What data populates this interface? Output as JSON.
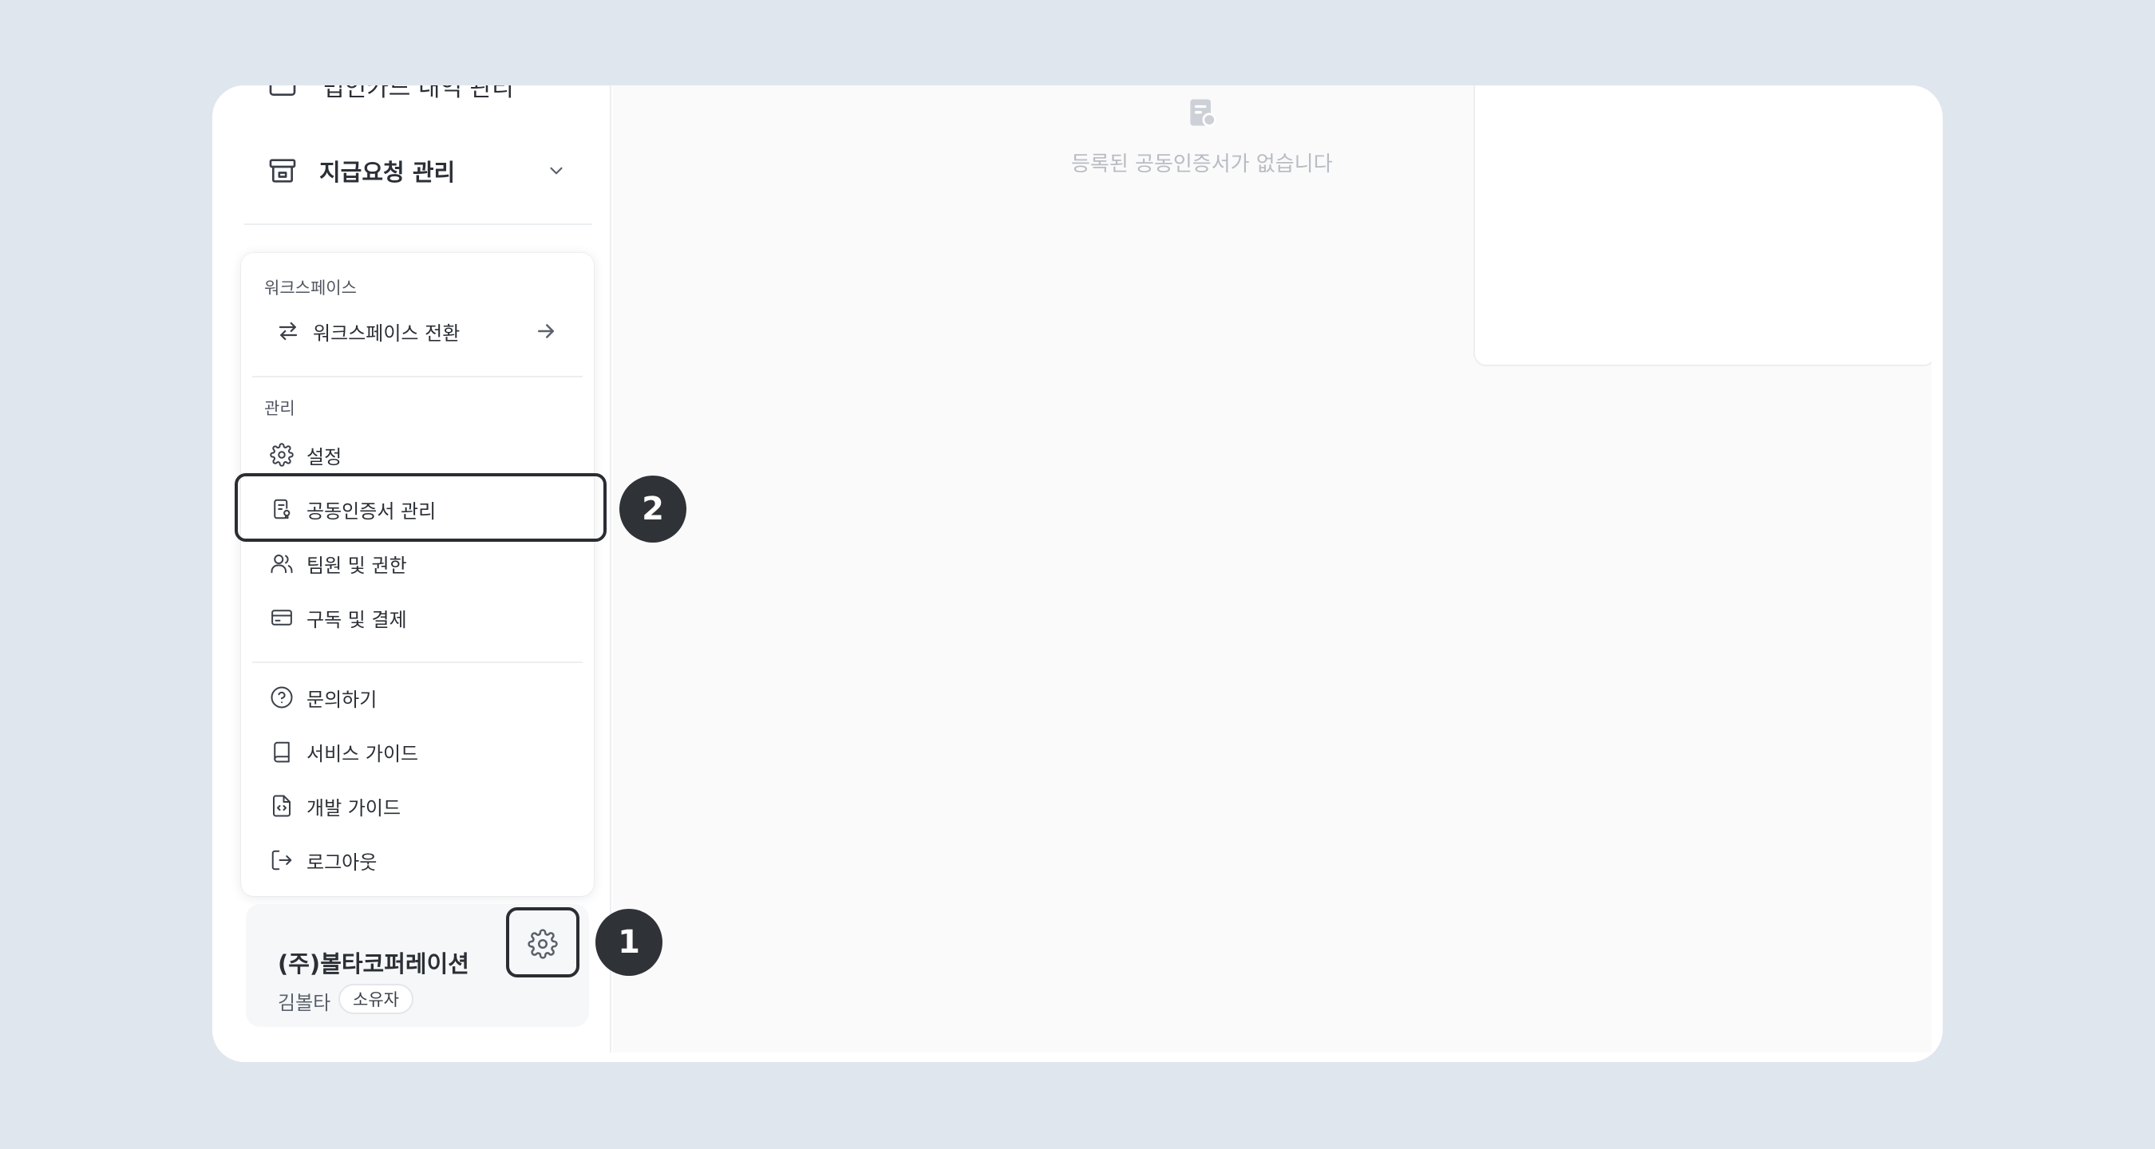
{
  "sidebar": {
    "cut_item_label": "법인카드 내역 관리",
    "payment_requests": {
      "label": "지급요청 관리",
      "icon": "archive-icon"
    }
  },
  "menu": {
    "workspace": {
      "title": "워크스페이스",
      "switch": {
        "label": "워크스페이스 전환",
        "icon": "switch-arrows-icon"
      }
    },
    "admin": {
      "title": "관리",
      "items": [
        {
          "label": "설정",
          "icon": "gear-icon"
        },
        {
          "label": "공동인증서 관리",
          "icon": "certificate-icon"
        },
        {
          "label": "팀원 및 권한",
          "icon": "users-icon"
        },
        {
          "label": "구독 및 결제",
          "icon": "credit-card-icon"
        }
      ]
    },
    "help": {
      "items": [
        {
          "label": "문의하기",
          "icon": "help-circle-icon"
        },
        {
          "label": "서비스 가이드",
          "icon": "book-icon"
        },
        {
          "label": "개발 가이드",
          "icon": "code-file-icon"
        },
        {
          "label": "로그아웃",
          "icon": "logout-icon"
        }
      ]
    }
  },
  "account": {
    "company": "(주)볼타코퍼레이션",
    "user": "김볼타",
    "role": "소유자"
  },
  "main": {
    "certificate_empty": "등록된 공동인증서가 없습니다"
  },
  "markers": {
    "step1": "1",
    "step2": "2"
  },
  "colors": {
    "background": "#dfe6ee",
    "marker": "#2f3237",
    "highlight_border": "#2a2d33",
    "empty_text": "#b8bcc3"
  }
}
